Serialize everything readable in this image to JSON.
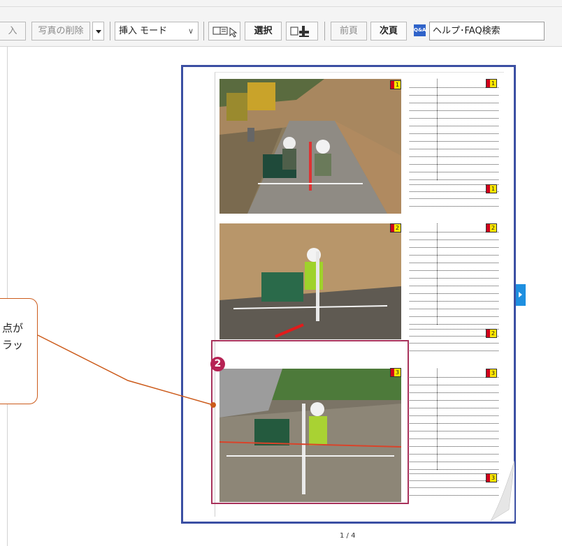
{
  "toolbar": {
    "insert_partial": "入",
    "delete_photo": "写真の削除",
    "insert_mode": "挿入 モード",
    "select": "選択",
    "prev_page": "前頁",
    "next_page": "次頁",
    "qa_icon_text": "Q&A",
    "help_search": "ヘルプ･FAQ検索"
  },
  "document": {
    "page_indicator": "1 / 4",
    "photo_numbers": [
      "1",
      "2",
      "3"
    ]
  },
  "annotation": {
    "step_number": "2",
    "callout_line1": "点が",
    "callout_line2": "ラッ"
  },
  "colors": {
    "frame": "#3b4fa3",
    "highlight": "#a8325b",
    "callout_border": "#cc5b1b",
    "nav_arrow": "#1e8fe0"
  }
}
